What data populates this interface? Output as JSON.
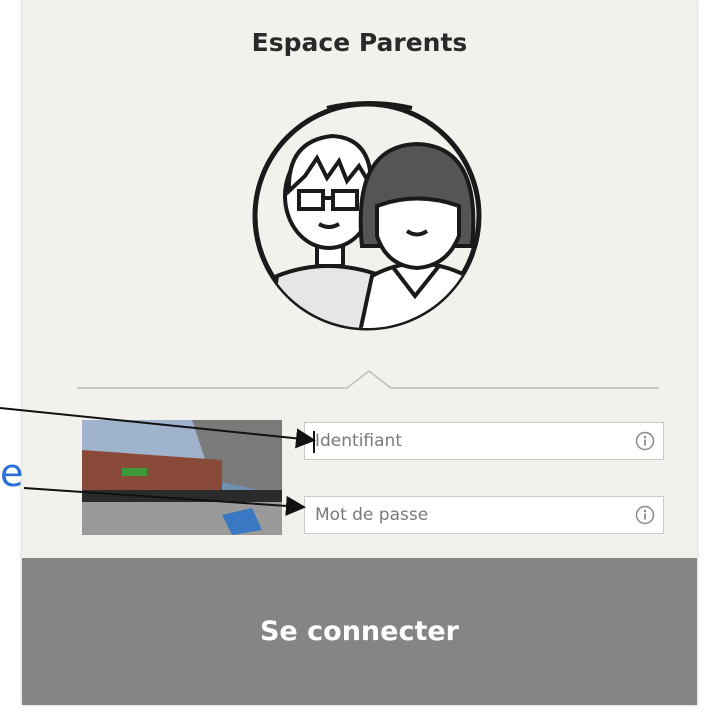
{
  "panel": {
    "title": "Espace Parents"
  },
  "form": {
    "identifiant_placeholder": "Identifiant",
    "password_placeholder": "Mot de passe"
  },
  "login_button": "Se connecter",
  "annotation": {
    "partial_text": "e",
    "color": "#2a6fd8"
  },
  "colors": {
    "button_bg": "#858585",
    "panel_bg": "#f2f1ec"
  },
  "icons": [
    "parents-avatar-icon",
    "info-icon",
    "arrow-annotation"
  ]
}
